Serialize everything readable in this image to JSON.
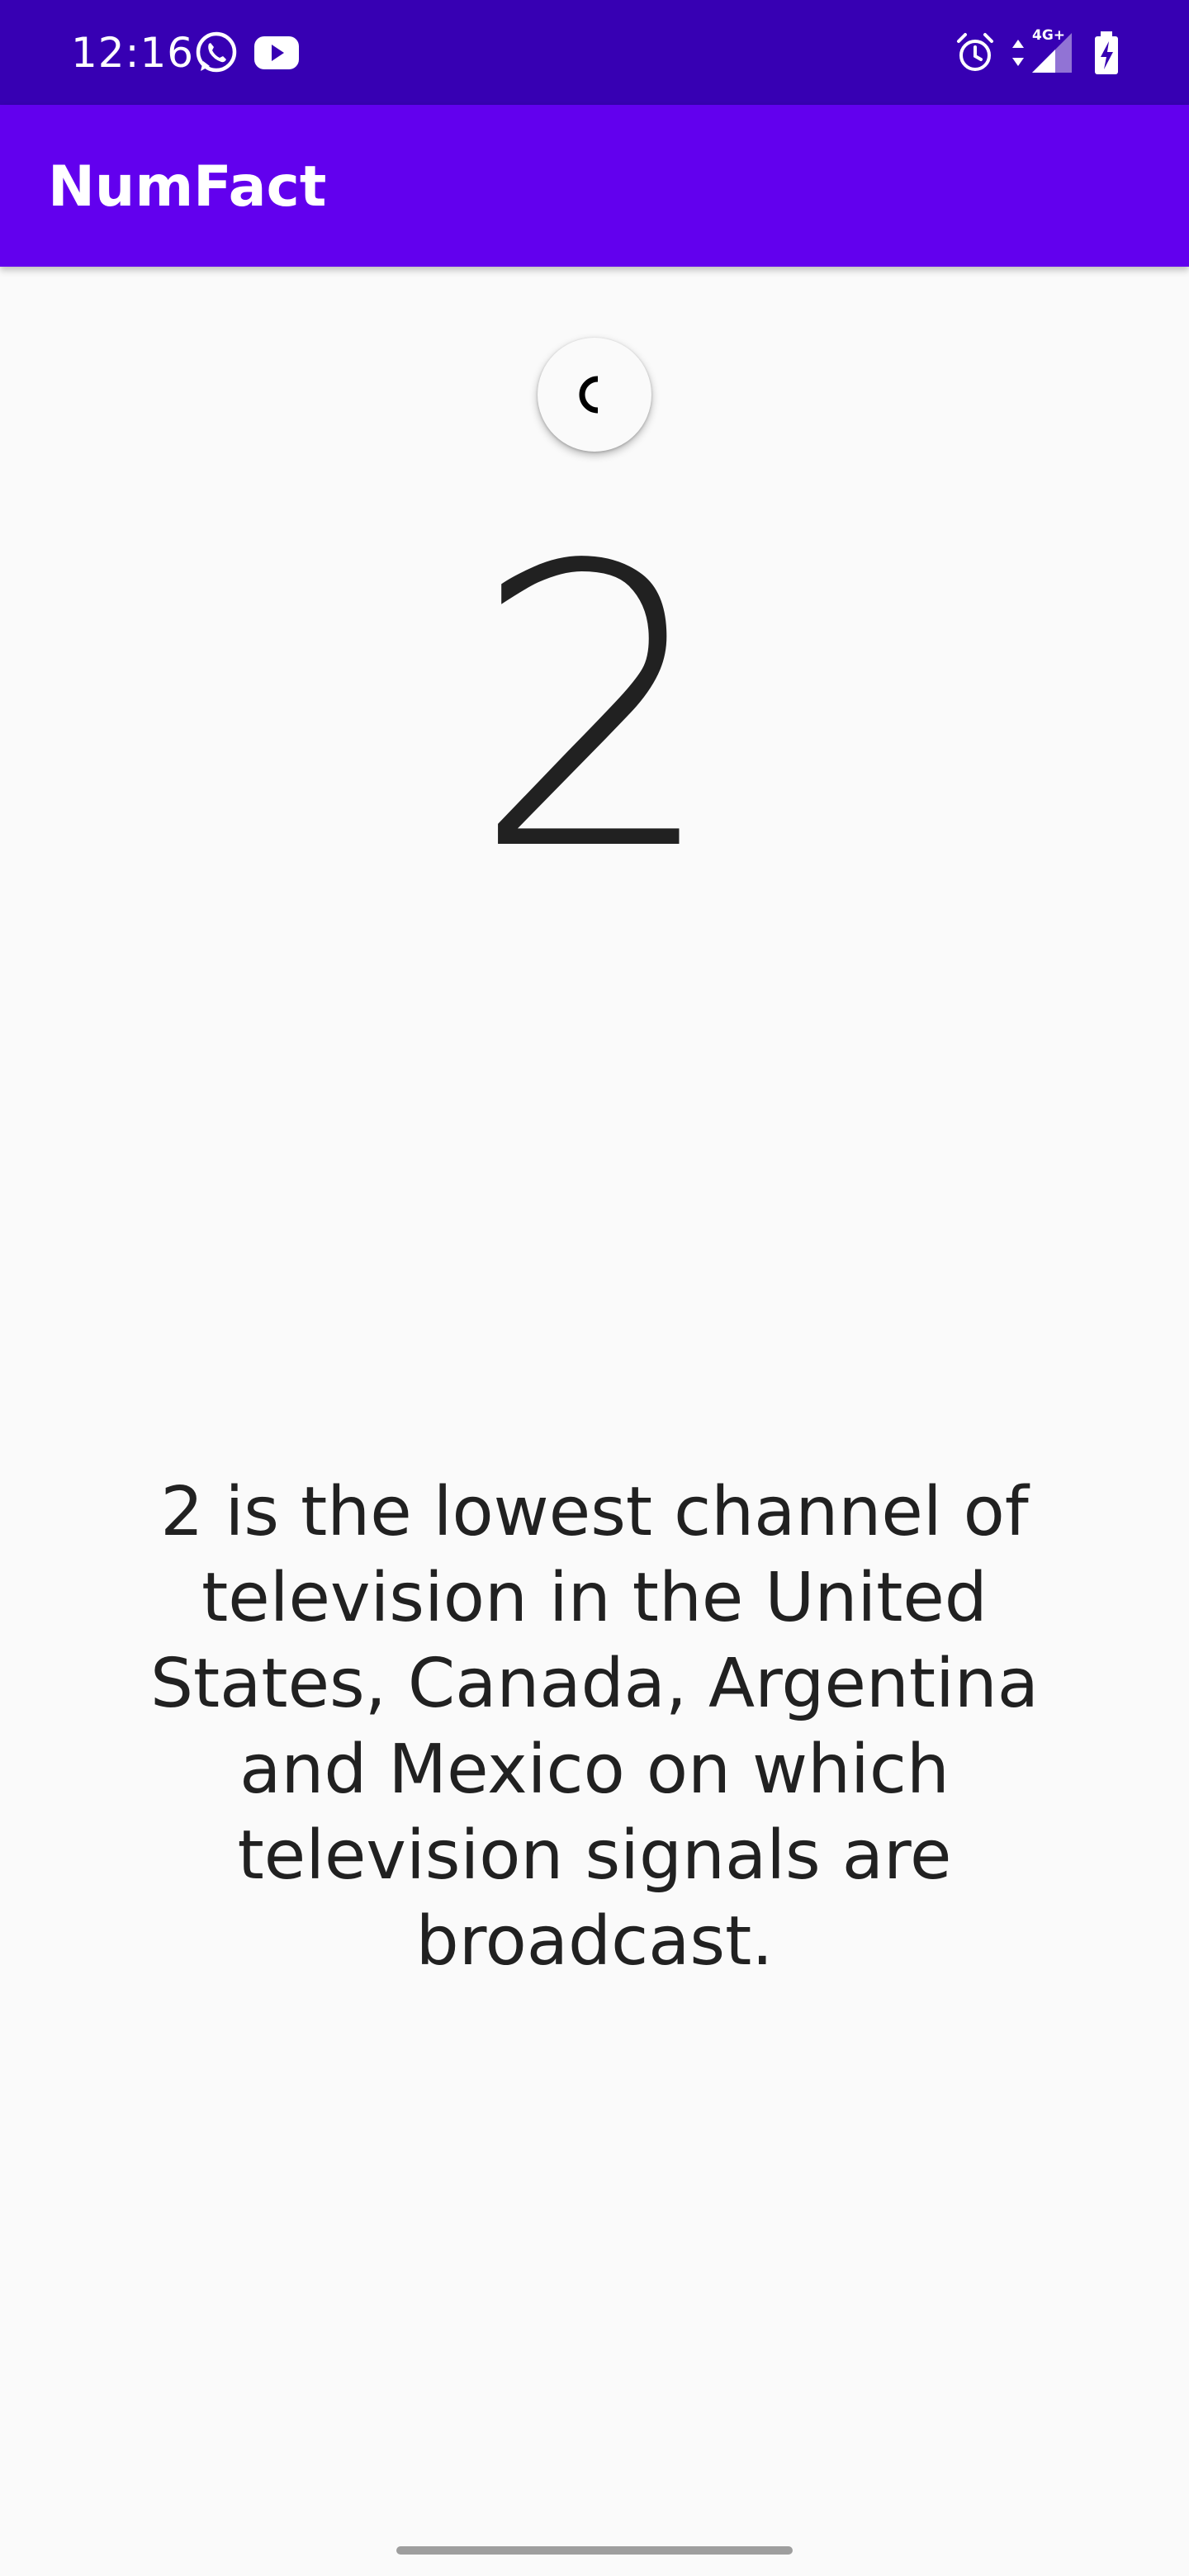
{
  "status_bar": {
    "time": "12:16",
    "notification_icons": [
      "whatsapp-icon",
      "youtube-icon"
    ],
    "system_icons": [
      "alarm-icon",
      "data-arrows-icon",
      "signal-4g-icon",
      "battery-charging-icon"
    ],
    "network_label": "4G+",
    "background_color": "#3700b3"
  },
  "app_bar": {
    "title": "NumFact",
    "background_color": "#6200ee"
  },
  "main": {
    "refresh_state": "loading",
    "number": "2",
    "fact": "2 is the lowest channel of television in the United States, Canada, Argentina and Mexico on which television signals are broadcast."
  }
}
